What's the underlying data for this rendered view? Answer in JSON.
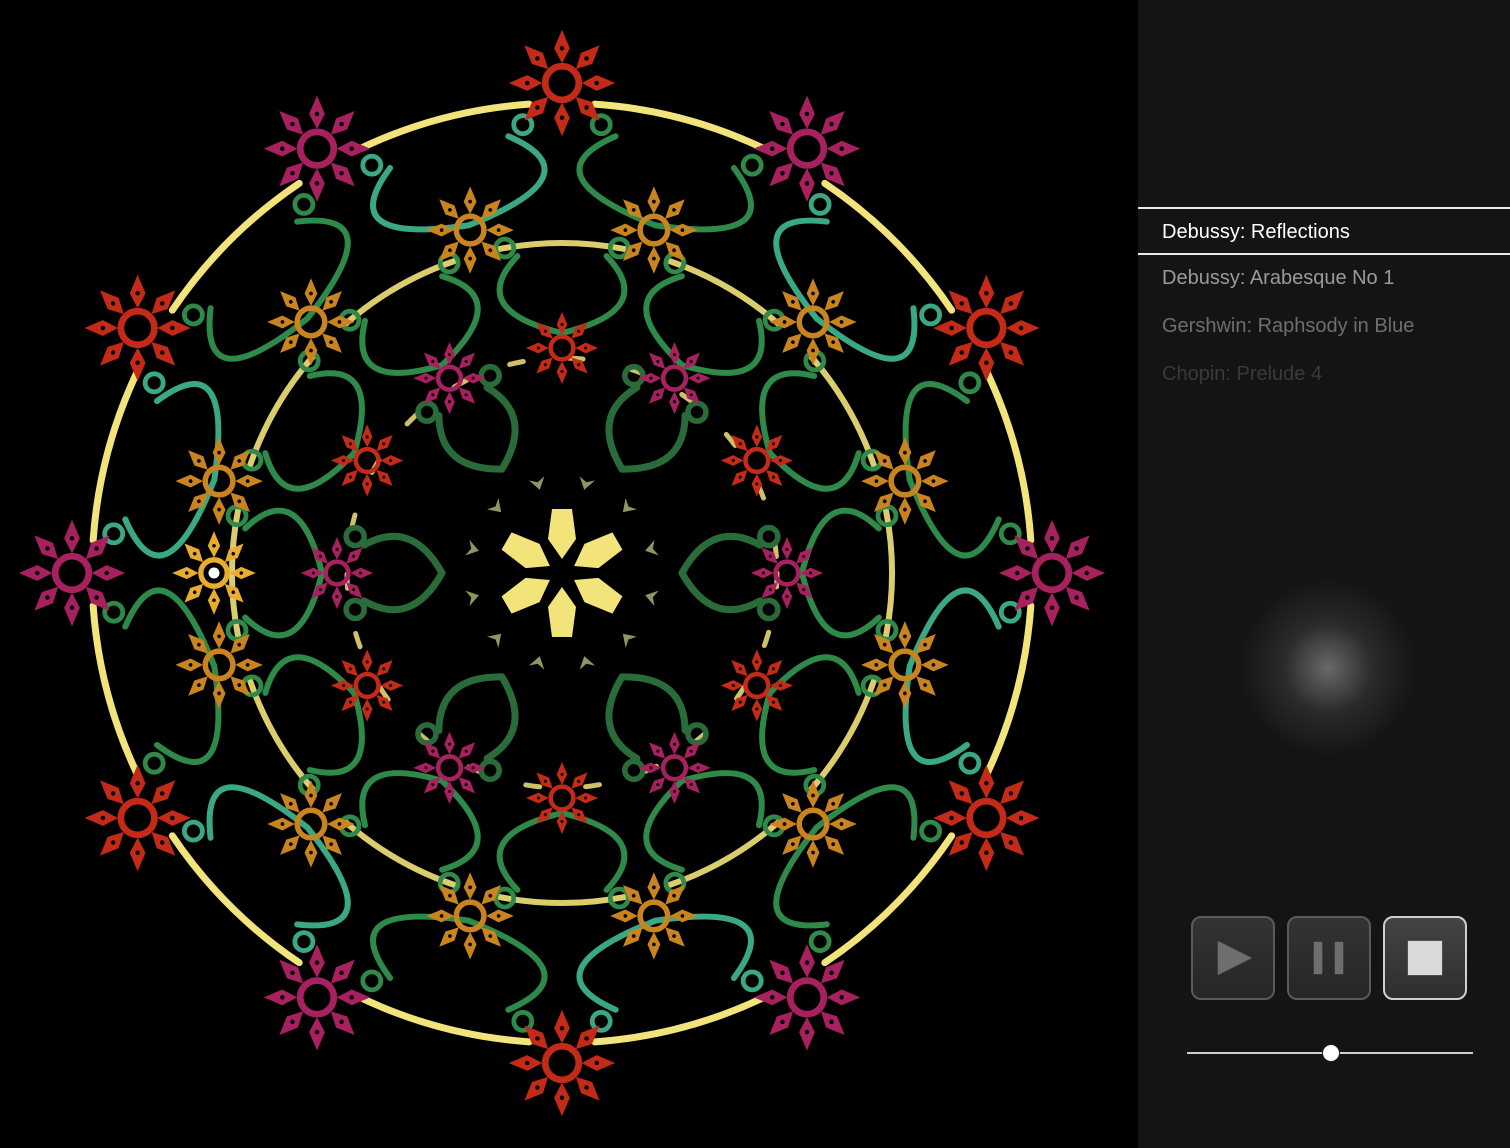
{
  "playlist": {
    "tracks": [
      {
        "label": "Debussy: Reflections",
        "active": true
      },
      {
        "label": "Debussy: Arabesque No 1",
        "active": false
      },
      {
        "label": "Gershwin: Raphsody in Blue",
        "active": false
      },
      {
        "label": "Chopin: Prelude 4",
        "active": false
      }
    ]
  },
  "controls": {
    "play_icon": "play-icon",
    "pause_icon": "pause-icon",
    "stop_icon": "stop-icon",
    "active": "stop"
  },
  "slider": {
    "value": 0.5
  },
  "colors": {
    "red": "#c42a18",
    "magenta": "#a8215f",
    "orange": "#c9841f",
    "amber": "#e8ac2f",
    "yellow": "#f2e37a",
    "green": "#2f8a4a",
    "teal": "#3aa882",
    "dark_green": "#2a6b3a"
  }
}
